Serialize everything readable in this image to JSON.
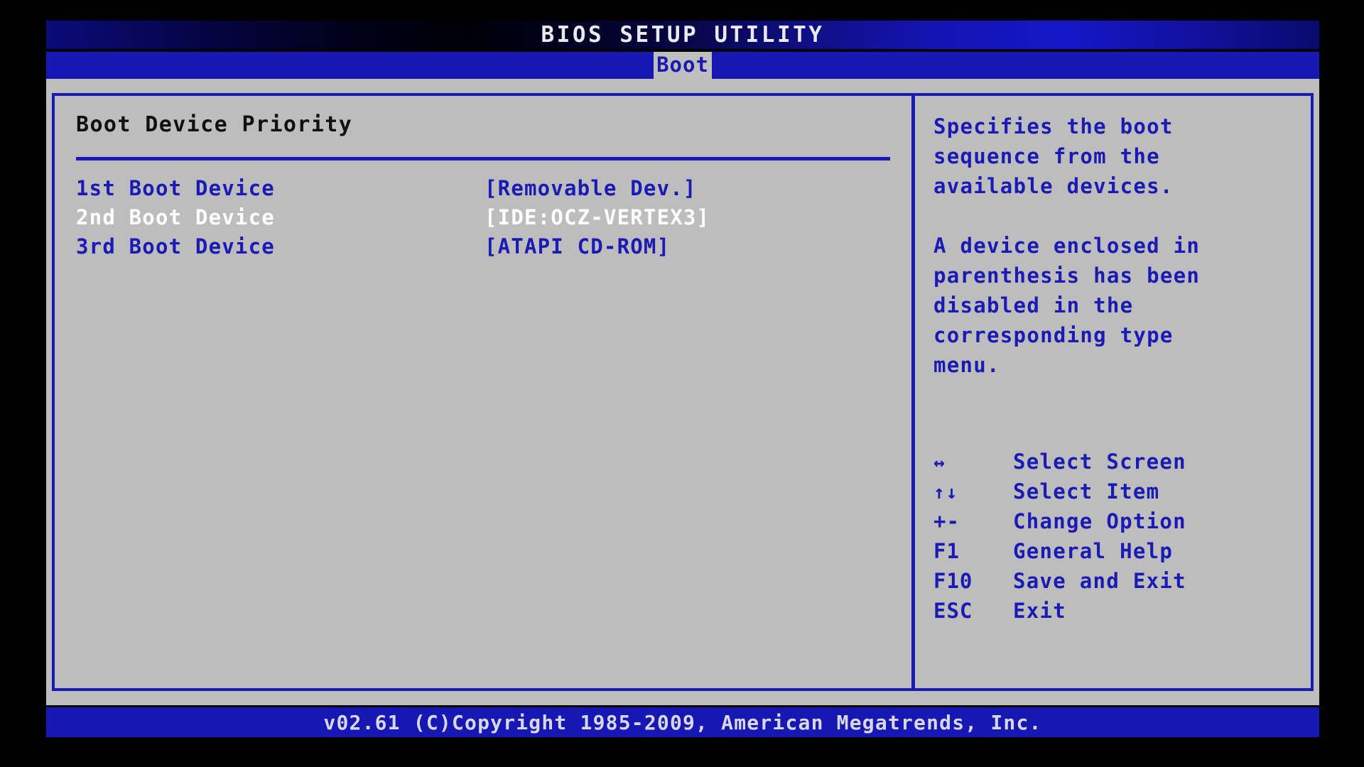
{
  "window": {
    "title": "BIOS SETUP UTILITY"
  },
  "menu": {
    "tabs": [
      {
        "label": "Boot",
        "active": true
      }
    ]
  },
  "main": {
    "section_title": "Boot Device Priority",
    "options": [
      {
        "label": "1st Boot Device",
        "value": "[Removable Dev.]",
        "selected": false
      },
      {
        "label": "2nd Boot Device",
        "value": "[IDE:OCZ-VERTEX3]",
        "selected": true
      },
      {
        "label": "3rd Boot Device",
        "value": "[ATAPI CD-ROM]",
        "selected": false
      }
    ]
  },
  "help": {
    "paragraph_1": "Specifies the boot\nsequence from the\navailable devices.",
    "paragraph_2": "A device enclosed in\nparenthesis has been\ndisabled in the\ncorresponding type\nmenu."
  },
  "legend": {
    "rows": [
      {
        "key": "↔",
        "desc": "Select Screen",
        "icon": "left-right-arrow-icon"
      },
      {
        "key": "↑↓",
        "desc": "Select Item",
        "icon": "up-down-arrow-icon"
      },
      {
        "key": "+-",
        "desc": "Change Option",
        "icon": "plus-minus-icon"
      },
      {
        "key": "F1",
        "desc": "General Help",
        "icon": "f1-key-icon"
      },
      {
        "key": "F10",
        "desc": "Save and Exit",
        "icon": "f10-key-icon"
      },
      {
        "key": "ESC",
        "desc": "Exit",
        "icon": "esc-key-icon"
      }
    ]
  },
  "footer": {
    "text": "v02.61 (C)Copyright 1985-2009, American Megatrends, Inc."
  },
  "colors": {
    "accent_blue": "#1a1ab4",
    "panel_grey": "#bdbdbd",
    "bar_blue": "#1717b4",
    "selected_white": "#ffffff",
    "title_text": "#e9e9ef",
    "heading_black": "#101010",
    "screen_black": "#000000"
  }
}
